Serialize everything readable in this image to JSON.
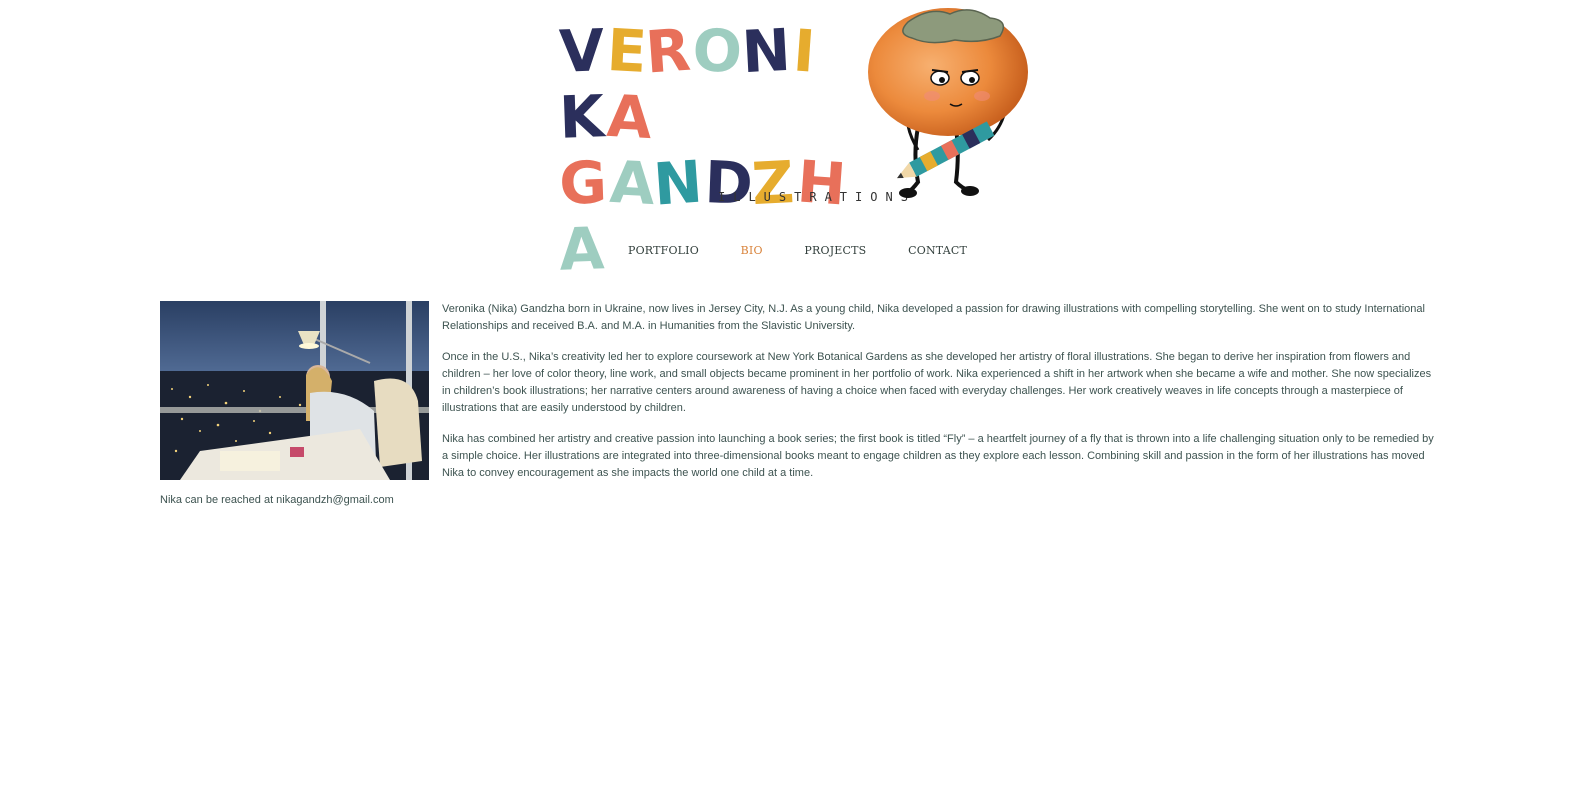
{
  "brand": {
    "line1": "VERONIKA",
    "line2": "GANDZHA",
    "subtitle": "ILLUSTRATIONS",
    "letter_colors_1": [
      "#2b2f5c",
      "#e6ac2e",
      "#e8705a",
      "#9ecdc0",
      "#2b2f5c",
      "#e6ac2e",
      "#2b2f5c",
      "#e8705a"
    ],
    "letter_colors_2": [
      "#e8705a",
      "#9ecdc0",
      "#2f9aa0",
      "#2b2f5c",
      "#e6ac2e",
      "#e8705a",
      "#9ecdc0"
    ],
    "mascot_icon": "persimmon-mascot-with-pencil"
  },
  "nav": {
    "items": [
      {
        "label": "PORTFOLIO",
        "active": false
      },
      {
        "label": "BIO",
        "active": true
      },
      {
        "label": "PROJECTS",
        "active": false
      },
      {
        "label": "CONTACT",
        "active": false
      }
    ],
    "active_color": "#d9843c"
  },
  "photo": {
    "icon": "artist-at-desk-photo"
  },
  "bio": {
    "p1": "Veronika (Nika) Gandzha born in Ukraine, now lives in Jersey City, N.J. As a young child, Nika developed a passion for drawing illustrations with compelling storytelling. She went on to study International Relationships and received B.A. and M.A. in Humanities from the Slavistic University.",
    "p2": "Once in the U.S., Nika’s creativity led her to explore coursework at New York Botanical Gardens as she developed her artistry of floral illustrations. She began to derive her inspiration from flowers and children – her love of color theory, line work, and small objects became prominent in her portfolio of work. Nika experienced a shift in her artwork when she became a wife and mother. She now specializes in children’s book illustrations; her narrative centers around awareness of having a choice when faced with everyday challenges. Her work creatively weaves in life concepts through a masterpiece of illustrations that are easily understood by children.",
    "p3": "Nika has combined her artistry and creative passion into launching a book series; the first book is titled “Fly” – a heartfelt journey of a fly that is thrown into a life challenging situation only to be remedied by a simple choice. Her illustrations are integrated into three-dimensional books meant to engage children as they explore each lesson. Combining skill and passion in the form of her illustrations has moved Nika to convey encouragement as she impacts the world one child at a time."
  },
  "contact_line": "Nika can be reached at nikagandzh@gmail.com"
}
